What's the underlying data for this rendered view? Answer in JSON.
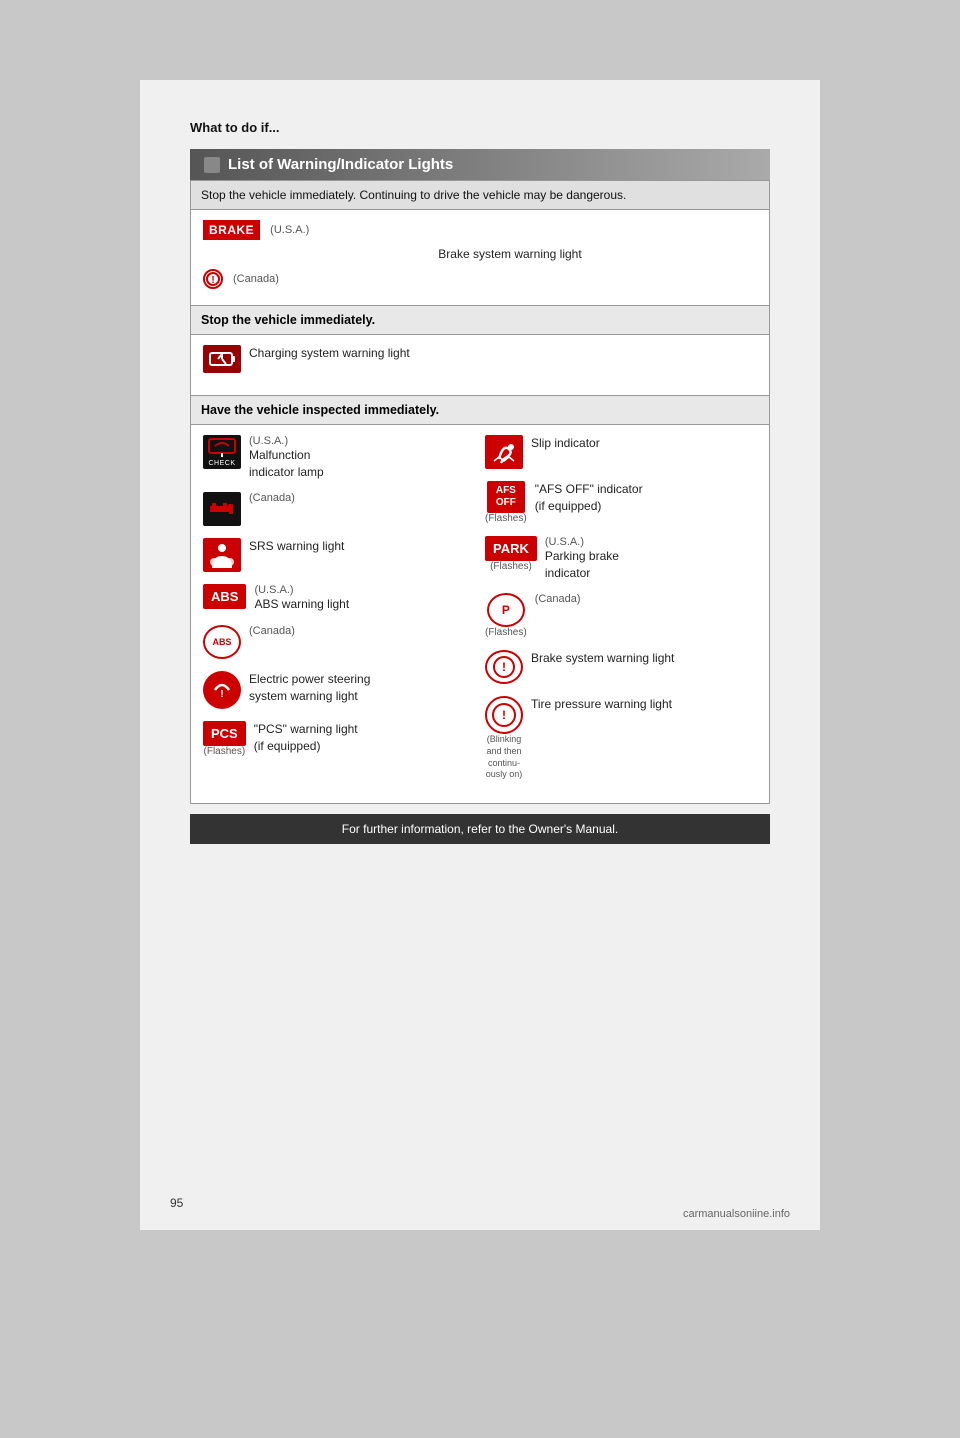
{
  "page": {
    "number": "95",
    "watermark": "carmanualsoniine.info"
  },
  "header": {
    "what_to_do": "What to do if..."
  },
  "section_title": "List of Warning/Indicator Lights",
  "stop_immediately_header": "Stop the vehicle immediately. Continuing to drive the vehicle may be dangerous.",
  "brake_usa_label": "BRAKE",
  "brake_usa_sublabel": "(U.S.A.)",
  "brake_system_label": "Brake system warning light",
  "brake_canada_sublabel": "(Canada)",
  "stop_immediately2_header": "Stop the vehicle immediately.",
  "charging_label": "Charging system warning light",
  "have_vehicle_header": "Have the vehicle inspected immediately.",
  "check_usa": "(U.S.A.)",
  "malfunction_label": "Malfunction",
  "malfunction_label2": "indicator lamp",
  "check_canada": "(Canada)",
  "srs_label": "SRS warning light",
  "abs_usa": "(U.S.A.)",
  "abs_label": "ABS warning light",
  "abs_canada": "(Canada)",
  "eps_label": "Electric power steering",
  "eps_label2": "system warning light",
  "pcs_label": "\"PCS\" warning light",
  "pcs_label2": "(if equipped)",
  "pcs_flashes": "(Flashes)",
  "slip_label": "Slip indicator",
  "afs_label": "\"AFS OFF\" indicator",
  "afs_label2": "(if equipped)",
  "afs_flashes": "(Flashes)",
  "park_usa": "(U.S.A.)",
  "park_label": "Parking brake",
  "park_label2": "indicator",
  "park_flashes": "(Flashes)",
  "park_canada": "(Canada)",
  "park_canada_flashes": "(Flashes)",
  "brake_warning_label": "Brake system warning light",
  "tire_blinking": "(Blinking",
  "tire_and_then": "and then",
  "tire_continu": "continu-",
  "tire_ously": "ously on)",
  "tire_label": "Tire pressure warning light",
  "footer_label": "For further information, refer to the Owner's Manual."
}
